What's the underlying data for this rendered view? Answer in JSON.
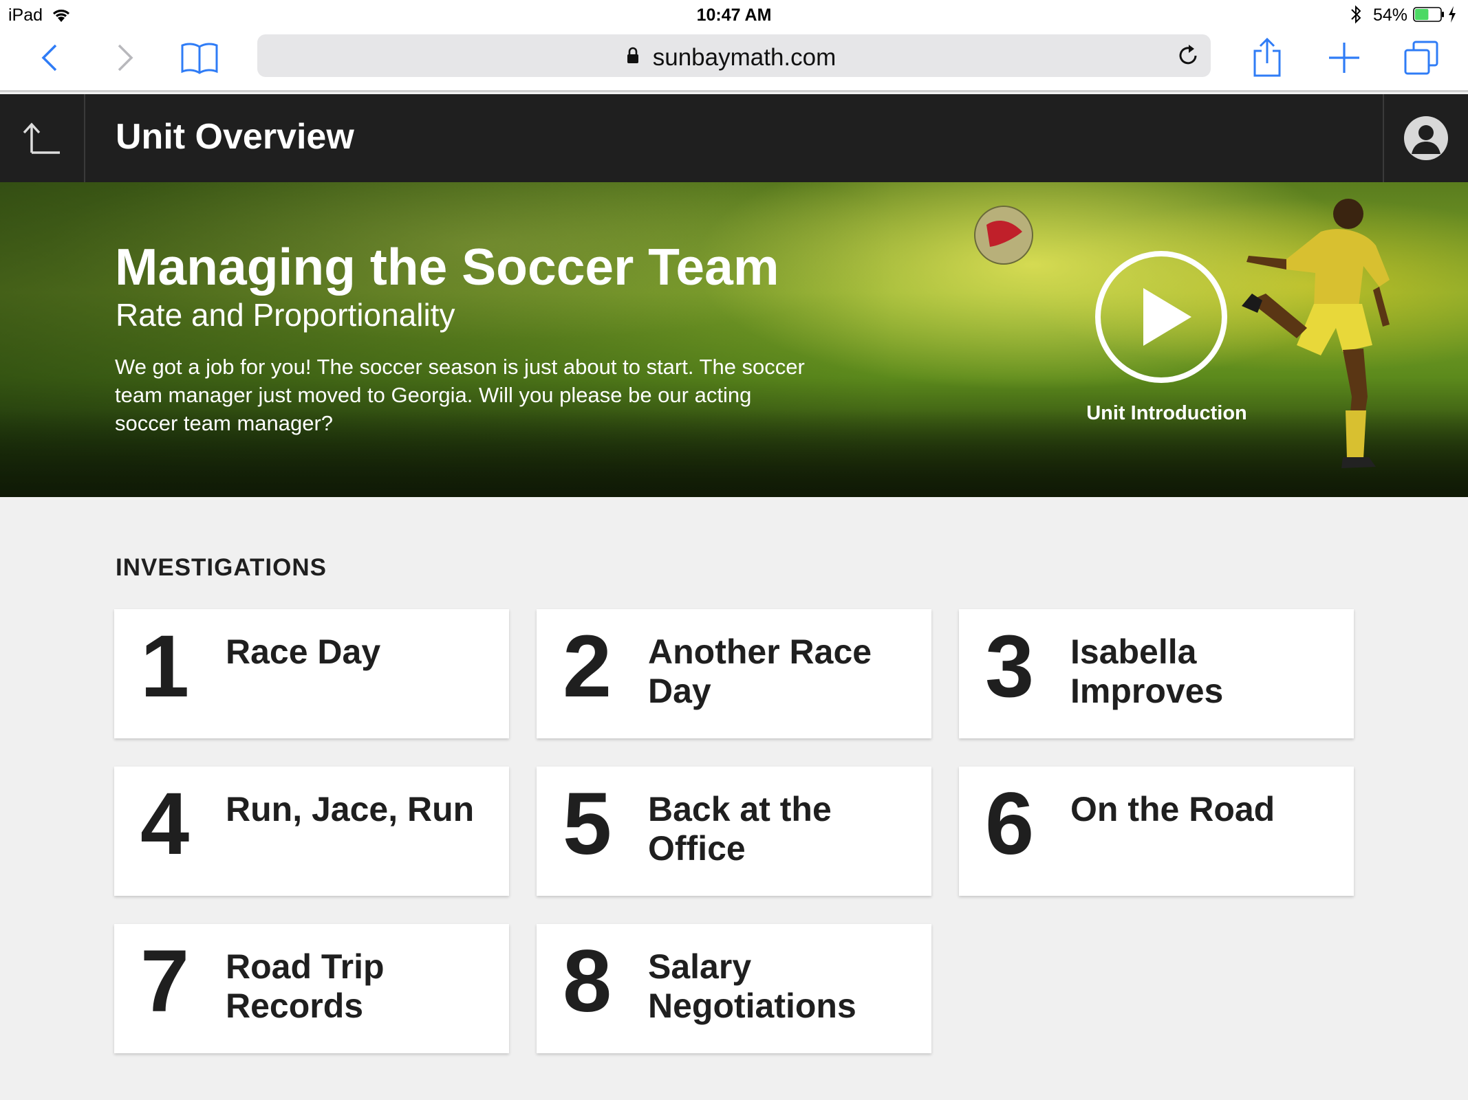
{
  "status_bar": {
    "device": "iPad",
    "time": "10:47 AM",
    "battery_percent": "54%",
    "battery_level": 0.54
  },
  "browser": {
    "url": "sunbaymath.com"
  },
  "app_header": {
    "title": "Unit Overview"
  },
  "hero": {
    "title": "Managing the Soccer Team",
    "subtitle": "Rate and Proportionality",
    "description": "We got a job for you! The soccer season is just about to start. The soccer team manager just moved to Georgia. Will you please be our acting soccer team manager?",
    "video_label": "Unit Introduction"
  },
  "investigations": {
    "heading": "INVESTIGATIONS",
    "items": [
      {
        "number": "1",
        "title": "Race Day"
      },
      {
        "number": "2",
        "title": "Another Race Day"
      },
      {
        "number": "3",
        "title": "Isabella Improves"
      },
      {
        "number": "4",
        "title": "Run, Jace, Run"
      },
      {
        "number": "5",
        "title": "Back at the Office"
      },
      {
        "number": "6",
        "title": "On the Road"
      },
      {
        "number": "7",
        "title": "Road Trip Records"
      },
      {
        "number": "8",
        "title": "Salary Negotiations"
      }
    ]
  },
  "colors": {
    "header_bg": "#1f1f1f",
    "page_bg": "#f0f0f0",
    "safari_accent": "#2f7cf6",
    "battery_green": "#4cd964"
  }
}
